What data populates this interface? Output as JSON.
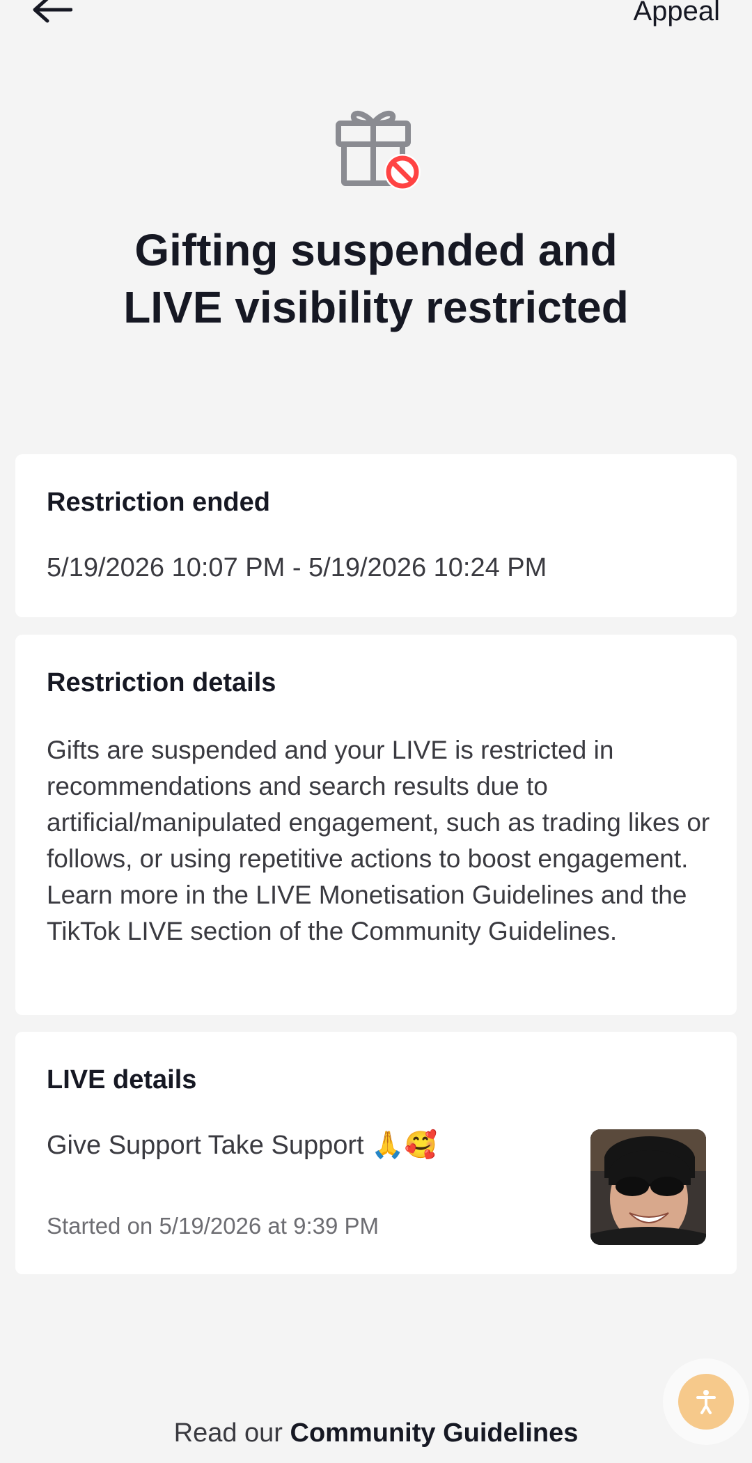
{
  "header": {
    "back_icon": "arrow-left-icon",
    "appeal_label": "Appeal"
  },
  "hero": {
    "icon": "gift-blocked-icon",
    "title_line1": "Gifting suspended and",
    "title_line2": "LIVE visibility restricted"
  },
  "restriction_ended": {
    "title": "Restriction ended",
    "period": "5/19/2026 10:07 PM - 5/19/2026 10:24 PM"
  },
  "restriction_details": {
    "title": "Restriction details",
    "body": "Gifts are suspended and your LIVE is restricted in recommendations and search results due to artificial/manipulated engagement, such as trading likes or follows, or using repetitive actions to boost engagement. Learn more in the LIVE Monetisation Guidelines and the TikTok LIVE section of the Community Guidelines."
  },
  "live_details": {
    "title": "LIVE details",
    "name": "Give Support Take Support 🙏🥰",
    "started": "Started on 5/19/2026 at 9:39 PM",
    "thumbnail": "live-thumbnail-avatar"
  },
  "footer": {
    "prefix": "Read our ",
    "link": "Community Guidelines"
  },
  "colors": {
    "background": "#f4f4f4",
    "card": "#ffffff",
    "block_red": "#ff4343",
    "icon_gray": "#8a8b91",
    "accessibility_orange": "#f6c98b"
  }
}
